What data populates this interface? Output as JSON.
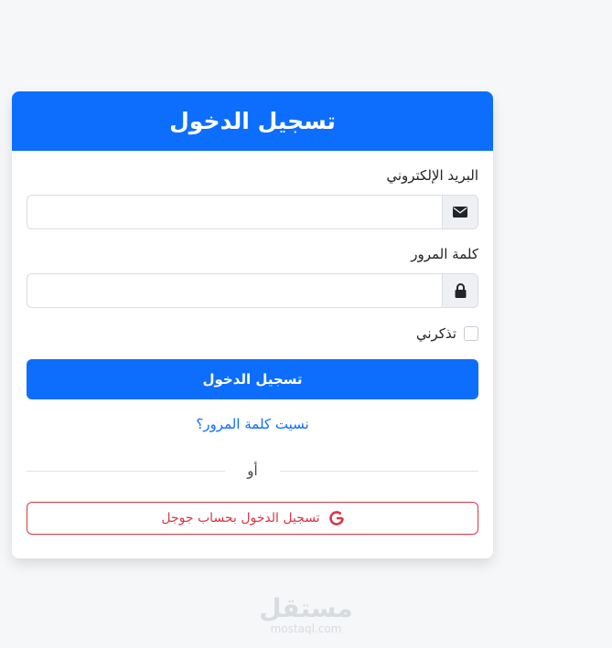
{
  "header": {
    "title": "تسجيل الدخول"
  },
  "form": {
    "email_label": "البريد الإلكتروني",
    "email_value": "",
    "email_placeholder": "",
    "password_label": "كلمة المرور",
    "password_value": "",
    "password_placeholder": "",
    "remember_label": "تذكرني",
    "remember_checked": false,
    "submit_label": "تسجيل الدخول",
    "forgot_label": "نسيت كلمة المرور؟",
    "divider_text": "أو",
    "google_label": "تسجيل الدخول بحساب جوجل"
  },
  "icons": {
    "email": "envelope-icon",
    "password": "lock-icon",
    "google": "google-icon"
  },
  "watermark": {
    "arabic": "مستقل",
    "english": "mostaql.com"
  },
  "colors": {
    "primary": "#0d6efd",
    "danger": "#dc3545",
    "background": "#f6f7f9"
  }
}
